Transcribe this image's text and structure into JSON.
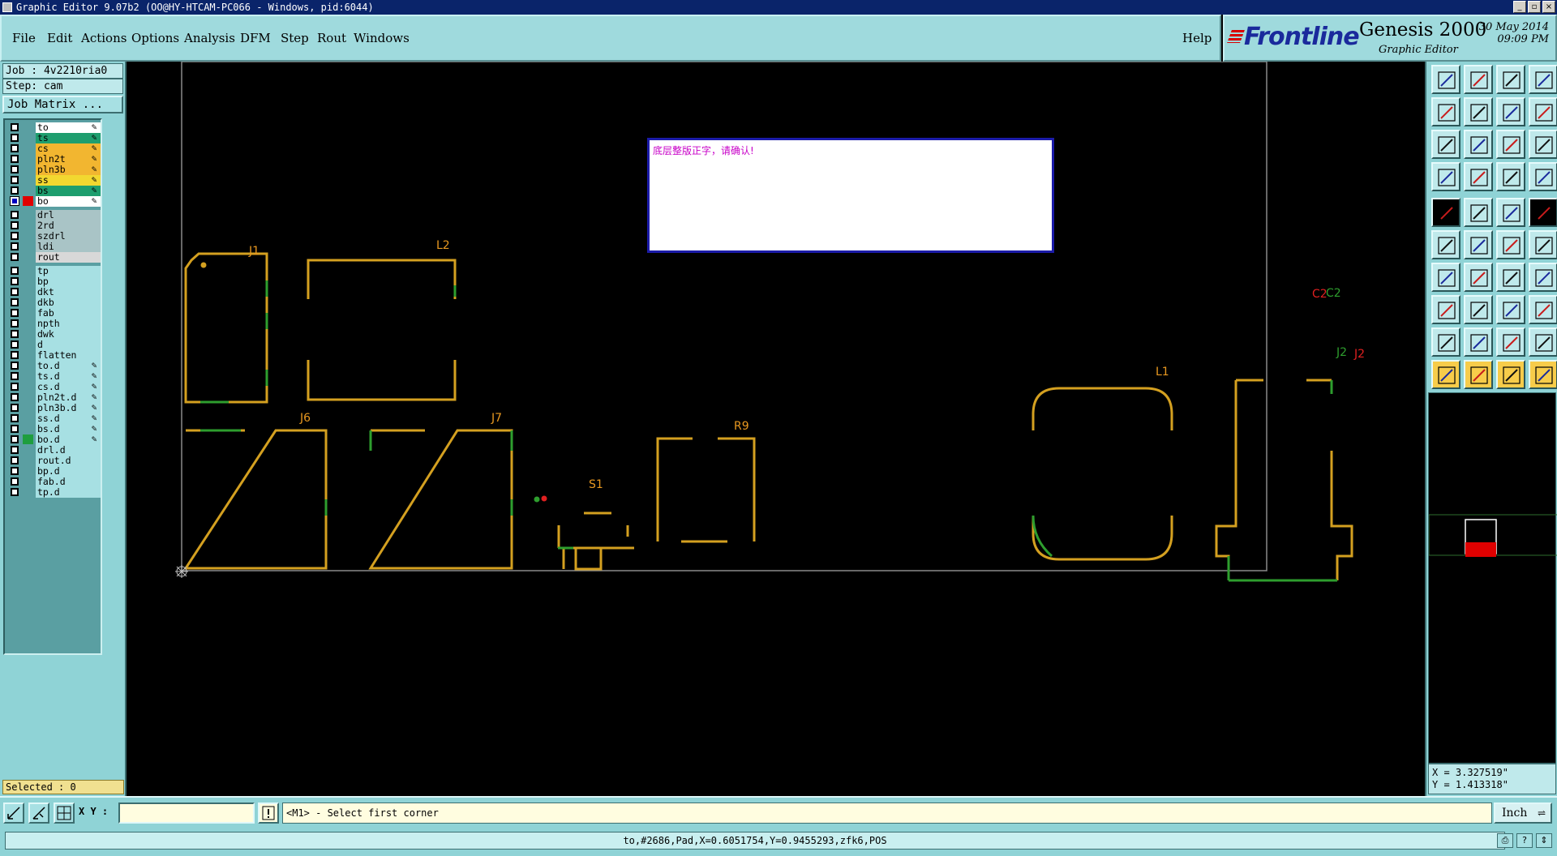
{
  "window": {
    "title": "Graphic Editor 9.07b2 (OO@HY-HTCAM-PC066 - Windows, pid:6044)",
    "buttons": [
      "_",
      "▫",
      "×"
    ]
  },
  "menubar": {
    "items": [
      "File",
      "Edit",
      "Actions",
      "Options",
      "Analysis",
      "DFM",
      "Step",
      "Rout",
      "Windows"
    ],
    "help": "Help"
  },
  "brand": {
    "logo": "Frontline",
    "product": "Genesis 2000",
    "subtitle": "Graphic Editor",
    "date": "30 May 2014",
    "time": "09:09 PM"
  },
  "leftpanel": {
    "job": "Job : 4v2210ria0",
    "step": "Step: cam",
    "job_matrix": "Job Matrix ...",
    "selected": "Selected : 0"
  },
  "layers": [
    {
      "name": "to",
      "bg": "#ffffff",
      "edit": true
    },
    {
      "name": "ts",
      "bg": "#1e9e6e",
      "edit": true
    },
    {
      "name": "cs",
      "bg": "#f2b630",
      "edit": true
    },
    {
      "name": "pln2t",
      "bg": "#f2b630",
      "edit": true
    },
    {
      "name": "pln3b",
      "bg": "#f2b630",
      "edit": true
    },
    {
      "name": "ss",
      "bg": "#f2d830",
      "edit": true
    },
    {
      "name": "bs",
      "bg": "#1e9e6e",
      "edit": true
    },
    {
      "name": "bo",
      "bg": "#ffffff",
      "edit": true,
      "active": true,
      "swatch": "#e00000"
    },
    {
      "name": "drl",
      "bg": "#a9c4c6",
      "edit": false
    },
    {
      "name": "2rd",
      "bg": "#a9c4c6",
      "edit": false
    },
    {
      "name": "szdrl",
      "bg": "#a9c4c6",
      "edit": false
    },
    {
      "name": "ldi",
      "bg": "#a9c4c6",
      "edit": false
    },
    {
      "name": "rout",
      "bg": "#d8d8d8",
      "edit": false
    },
    {
      "name": "tp",
      "bg": "#a7e0e3",
      "edit": false
    },
    {
      "name": "bp",
      "bg": "#a7e0e3",
      "edit": false
    },
    {
      "name": "dkt",
      "bg": "#a7e0e3",
      "edit": false
    },
    {
      "name": "dkb",
      "bg": "#a7e0e3",
      "edit": false
    },
    {
      "name": "fab",
      "bg": "#a7e0e3",
      "edit": false
    },
    {
      "name": "npth",
      "bg": "#a7e0e3",
      "edit": false
    },
    {
      "name": "dwk",
      "bg": "#a7e0e3",
      "edit": false
    },
    {
      "name": "d",
      "bg": "#a7e0e3",
      "edit": false
    },
    {
      "name": "flatten",
      "bg": "#a7e0e3",
      "edit": false
    },
    {
      "name": "to.d",
      "bg": "#a7e0e3",
      "edit": true
    },
    {
      "name": "ts.d",
      "bg": "#a7e0e3",
      "edit": true
    },
    {
      "name": "cs.d",
      "bg": "#a7e0e3",
      "edit": true
    },
    {
      "name": "pln2t.d",
      "bg": "#a7e0e3",
      "edit": true
    },
    {
      "name": "pln3b.d",
      "bg": "#a7e0e3",
      "edit": true
    },
    {
      "name": "ss.d",
      "bg": "#a7e0e3",
      "edit": true
    },
    {
      "name": "bs.d",
      "bg": "#a7e0e3",
      "edit": true
    },
    {
      "name": "bo.d",
      "bg": "#a7e0e3",
      "edit": true,
      "swatch": "#1e9e3e"
    },
    {
      "name": "drl.d",
      "bg": "#a7e0e3",
      "edit": false
    },
    {
      "name": "rout.d",
      "bg": "#a7e0e3",
      "edit": false
    },
    {
      "name": "bp.d",
      "bg": "#a7e0e3",
      "edit": false
    },
    {
      "name": "fab.d",
      "bg": "#a7e0e3",
      "edit": false
    },
    {
      "name": "tp.d",
      "bg": "#a7e0e3",
      "edit": false
    }
  ],
  "canvas": {
    "message": "底层整版正字，请确认!",
    "refdes": [
      "J1",
      "L2",
      "J6",
      "J7",
      "R9",
      "S1",
      "L1",
      "C2",
      "C2",
      "J2",
      "J2"
    ],
    "colors": {
      "outline": "#d4a020",
      "green": "#2e9e2e",
      "label": "#e89820",
      "red": "#e02020"
    }
  },
  "coords": {
    "x": "X = 3.327519\"",
    "y": "Y = 1.413318\""
  },
  "bottombar": {
    "xy_label": "X Y :",
    "xy_value": "",
    "prompt": "<M1> - Select first corner",
    "unit": "Inch"
  },
  "status": {
    "text": "to,#2686,Pad,X=0.6051754,Y=0.9455293,zfk6,POS"
  }
}
